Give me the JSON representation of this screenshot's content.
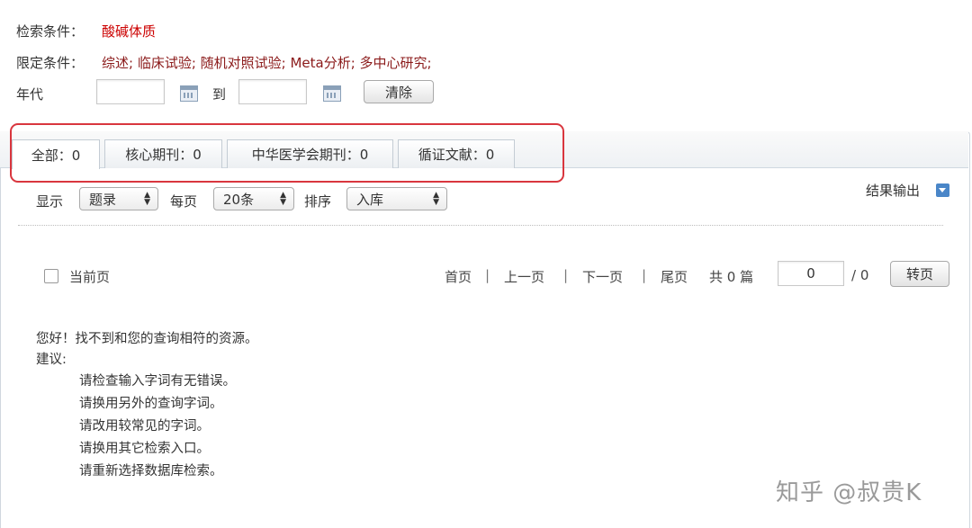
{
  "search": {
    "condition_label": "检索条件：",
    "condition_value": "酸碱体质",
    "limit_label": "限定条件：",
    "limit_value": "综述; 临床试验; 随机对照试验; Meta分析; 多中心研究;",
    "year_label": "年代",
    "year_from": "",
    "year_to_label": "到",
    "year_to": "",
    "clear_button": "清除"
  },
  "tabs": [
    {
      "label": "全部：0",
      "active": true
    },
    {
      "label": "核心期刊：0",
      "active": false
    },
    {
      "label": "中华医学会期刊：0",
      "active": false
    },
    {
      "label": "循证文献：0",
      "active": false
    }
  ],
  "options": {
    "display_label": "显示",
    "display_value": "题录",
    "per_page_label": "每页",
    "per_page_value": "20条",
    "sort_label": "排序",
    "sort_value": "入库",
    "export_label": "结果输出"
  },
  "pagination": {
    "current_page_label": "当前页",
    "first": "首页",
    "prev": "上一页",
    "next": "下一页",
    "last": "尾页",
    "total": "共 0 篇",
    "page_input": "0",
    "page_total": "/ 0",
    "go_button": "转页",
    "separator": "|"
  },
  "message": {
    "line1": "您好！找不到和您的查询相符的资源。",
    "suggest_label": "建议:",
    "suggestions": [
      "请检查输入字词有无错误。",
      "请换用另外的查询字词。",
      "请改用较常见的字词。",
      "请换用其它检索入口。",
      "请重新选择数据库检索。"
    ]
  },
  "watermark": "知乎 @叔贵K",
  "colors": {
    "highlight": "#d9363e",
    "condition": "#cc0000",
    "limit": "#8b1a1a",
    "accent": "#4a86c8"
  }
}
